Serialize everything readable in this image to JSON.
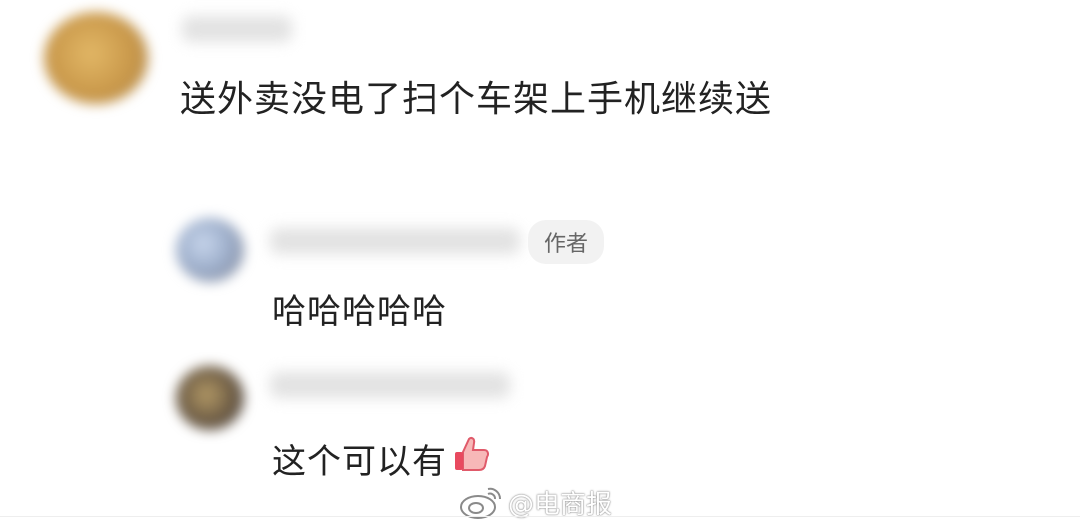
{
  "comment": {
    "text": "送外卖没电了扫个车架上手机继续送"
  },
  "replies": [
    {
      "text": "哈哈哈哈哈",
      "badge": "作者"
    },
    {
      "text": "这个可以有",
      "icon": "thumbs-up-icon"
    }
  ],
  "watermark": {
    "text": "@电商报",
    "icon": "weibo-logo-icon"
  }
}
